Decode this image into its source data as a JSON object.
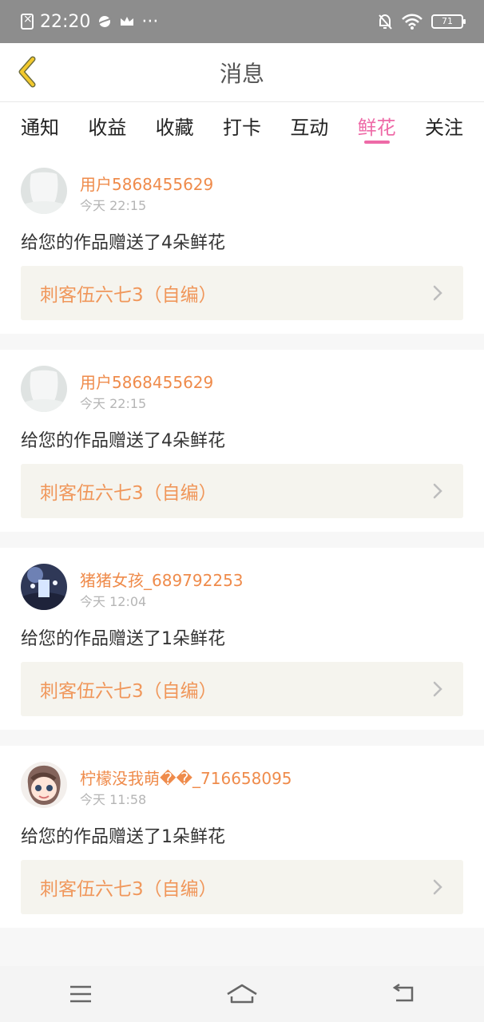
{
  "status_bar": {
    "time": "22:20",
    "battery": "71",
    "more": "···",
    "icons": [
      "sim-off-icon",
      "planet-icon",
      "crown-icon",
      "mute-icon",
      "wifi-icon",
      "battery-icon"
    ]
  },
  "header": {
    "title": "消息",
    "back_icon": "chevron-left-icon"
  },
  "tabs": [
    {
      "label": "通知"
    },
    {
      "label": "收益"
    },
    {
      "label": "收藏"
    },
    {
      "label": "打卡"
    },
    {
      "label": "互动"
    },
    {
      "label": "鲜花",
      "active": true
    },
    {
      "label": "关注"
    }
  ],
  "messages": [
    {
      "user": "用户5868455629",
      "time": "今天 22:15",
      "text": "给您的作品赠送了4朵鲜花",
      "work": "刺客伍六七3（自编）",
      "avatar": "default-avatar"
    },
    {
      "user": "用户5868455629",
      "time": "今天 22:15",
      "text": "给您的作品赠送了4朵鲜花",
      "work": "刺客伍六七3（自编）",
      "avatar": "default-avatar"
    },
    {
      "user": "猪猪女孩_689792253",
      "time": "今天 12:04",
      "text": "给您的作品赠送了1朵鲜花",
      "work": "刺客伍六七3（自编）",
      "avatar": "photo-avatar"
    },
    {
      "user": "柠檬没我萌��_716658095",
      "time": "今天 11:58",
      "text": "给您的作品赠送了1朵鲜花",
      "work": "刺客伍六七3（自编）",
      "avatar": "anime-avatar"
    }
  ],
  "bottom_nav": {
    "items": [
      "menu-icon",
      "home-icon",
      "back-icon"
    ]
  },
  "colors": {
    "accent": "#ee6aa7",
    "username": "#ef8b4b",
    "work_title": "#f0975b",
    "status_bar": "#8d8d8d"
  }
}
